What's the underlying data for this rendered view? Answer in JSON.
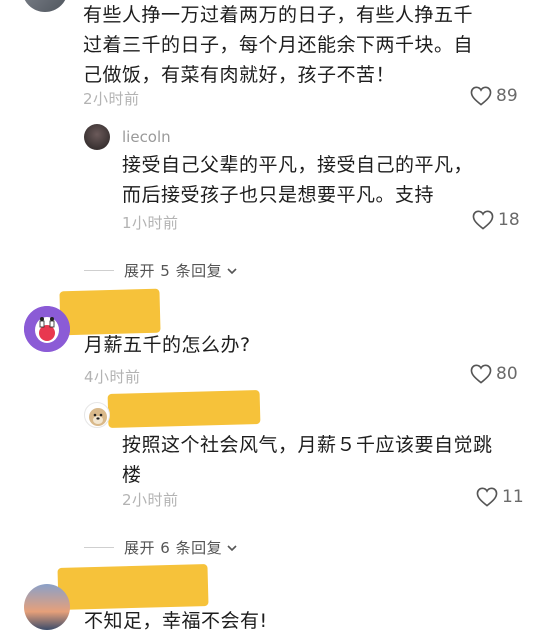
{
  "comments": [
    {
      "text_lines": [
        "有些人挣一万过着两万的日子，有些人挣五千",
        "过着三千的日子，每个月还能余下两千块。自",
        "己做饭，有菜有肉就好，孩子不苦！"
      ],
      "time": "2小时前",
      "likes": "89",
      "reply": {
        "username": "liecoln",
        "text_lines": [
          "接受自己父辈的平凡，接受自己的平凡，",
          "而后接受孩子也只是想要平凡。支持"
        ],
        "time": "1小时前",
        "likes": "18"
      },
      "expand_label": "展开 5 条回复"
    },
    {
      "text_lines": [
        "月薪五千的怎么办?"
      ],
      "time": "4小时前",
      "likes": "80",
      "reply": {
        "text_lines": [
          "按照这个社会风气，月薪５千应该要自觉跳",
          "楼"
        ],
        "time": "2小时前",
        "likes": "11"
      },
      "expand_label": "展开 6 条回复"
    },
    {
      "text_lines": [
        "不知足，幸福不会有!"
      ]
    }
  ]
}
